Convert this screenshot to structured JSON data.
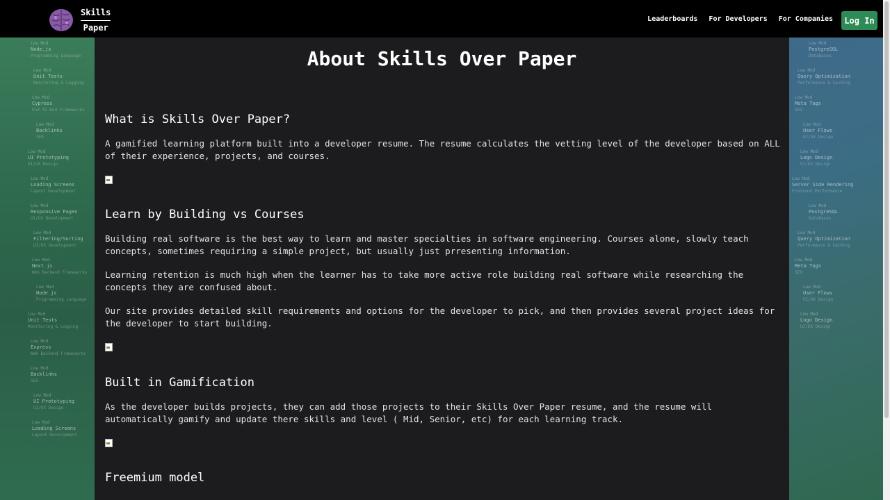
{
  "header": {
    "logo_line1": "Skills",
    "logo_line2": "Paper",
    "nav": [
      "Leaderboards",
      "For Developers",
      "For Companies"
    ],
    "login_label": "Log In"
  },
  "main": {
    "title": "About Skills Over Paper",
    "sections": [
      {
        "heading": "What is Skills Over Paper?",
        "paragraphs": [
          "A gamified learning platform built into a developer resume. The resume calculates the vetting level of the developer based on ALL of their experience, projects, and courses."
        ]
      },
      {
        "heading": "Learn by Building vs Courses",
        "paragraphs": [
          "Building real software is the best way to learn and master specialties in software engineering. Courses alone, slowly teach concepts, sometimes requiring a simple project, but usually just prresenting information.",
          "Learning retention is much high when the learner has to take more active role building real software while researching the concepts they are confused about.",
          "Our site provides detailed skill requirements and options for the developer to pick, and then provides several project ideas for the developer to start building."
        ]
      },
      {
        "heading": "Built in Gamification",
        "paragraphs": [
          "As the developer builds projects, they can add those projects to their Skills Over Paper resume, and the resume will automatically gamify and update there skills and level ( Mid, Senior, etc) for each learning track."
        ]
      },
      {
        "heading": "Freemium model",
        "paragraphs": []
      }
    ]
  },
  "background": {
    "left_chips": [
      {
        "label": "Node.js",
        "sub": "Programming Language"
      },
      {
        "label": "Unit Tests",
        "sub": "Monitoring & Logging"
      },
      {
        "label": "Cypress",
        "sub": "End-To-End Frameworks"
      },
      {
        "label": "Backlinks",
        "sub": "SEO"
      },
      {
        "label": "UI Prototyping",
        "sub": "UI/UX Design"
      },
      {
        "label": "Loading Screens",
        "sub": "Layout Development"
      },
      {
        "label": "Responsive Pages",
        "sub": "UI/UX Development"
      },
      {
        "label": "Filtering/Sorting",
        "sub": "UI/UX Development"
      },
      {
        "label": "Next.js",
        "sub": "Web Backend Frameworks"
      },
      {
        "label": "Node.js",
        "sub": "Programming Language"
      },
      {
        "label": "Unit Tests",
        "sub": "Monitoring & Logging"
      },
      {
        "label": "Express",
        "sub": "Web Backend Frameworks"
      },
      {
        "label": "Backlinks",
        "sub": "SEO"
      },
      {
        "label": "UI Prototyping",
        "sub": "UI/UX Design"
      },
      {
        "label": "Loading Screens",
        "sub": "Layout Development"
      }
    ],
    "right_chips": [
      {
        "label": "PostgreSQL",
        "sub": "Databases"
      },
      {
        "label": "Query Optimization",
        "sub": "Performance & Caching"
      },
      {
        "label": "Meta Tags",
        "sub": "SEO"
      },
      {
        "label": "User Flows",
        "sub": "UI/UX Design"
      },
      {
        "label": "Logo Design",
        "sub": "UI/UX Design"
      },
      {
        "label": "Server Side Rendering",
        "sub": "Frontend Performance"
      },
      {
        "label": "PostgreSQL",
        "sub": "Databases"
      },
      {
        "label": "Query Optimization",
        "sub": "Performance & Caching"
      },
      {
        "label": "Meta Tags",
        "sub": "SEO"
      },
      {
        "label": "User Flows",
        "sub": "UI/UX Design"
      },
      {
        "label": "Logo Design",
        "sub": "UI/UX Design"
      }
    ],
    "chip_level": "Low Mod"
  },
  "colors": {
    "accent": "#2e8b57",
    "header_bg": "#000000",
    "content_bg": "#1c1c1e"
  }
}
